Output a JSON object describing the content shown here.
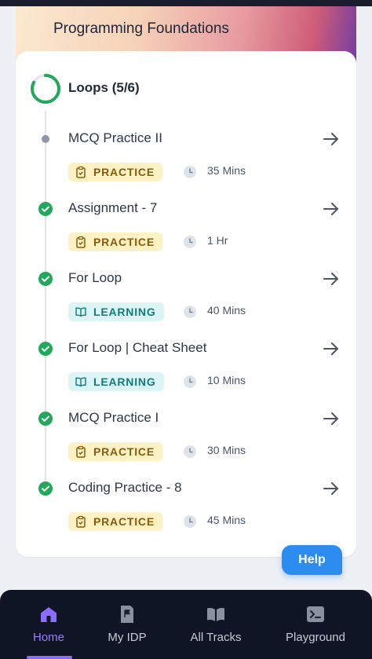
{
  "header": {
    "title": "Programming Foundations"
  },
  "section": {
    "title": "Loops (5/6)",
    "progress": 0.83
  },
  "items": [
    {
      "title": "MCQ Practice II",
      "type": "PRACTICE",
      "duration": "35 Mins",
      "completed": false
    },
    {
      "title": "Assignment - 7",
      "type": "PRACTICE",
      "duration": "1 Hr",
      "completed": true
    },
    {
      "title": "For Loop",
      "type": "LEARNING",
      "duration": "40 Mins",
      "completed": true
    },
    {
      "title": "For Loop | Cheat Sheet",
      "type": "LEARNING",
      "duration": "10 Mins",
      "completed": true
    },
    {
      "title": "MCQ Practice I",
      "type": "PRACTICE",
      "duration": "30 Mins",
      "completed": true
    },
    {
      "title": "Coding Practice - 8",
      "type": "PRACTICE",
      "duration": "45 Mins",
      "completed": true
    }
  ],
  "help": {
    "label": "Help"
  },
  "nav": {
    "items": [
      {
        "label": "Home",
        "icon": "home-icon",
        "active": true
      },
      {
        "label": "My IDP",
        "icon": "flag-document-icon",
        "active": false
      },
      {
        "label": "All Tracks",
        "icon": "open-book-icon",
        "active": false
      },
      {
        "label": "Playground",
        "icon": "terminal-icon",
        "active": false
      }
    ]
  },
  "colors": {
    "accent": "#8b6cff",
    "success": "#22a85a",
    "help": "#2d8cf0",
    "practice_bg": "#fdf2c4",
    "learning_bg": "#dcf5f4"
  }
}
